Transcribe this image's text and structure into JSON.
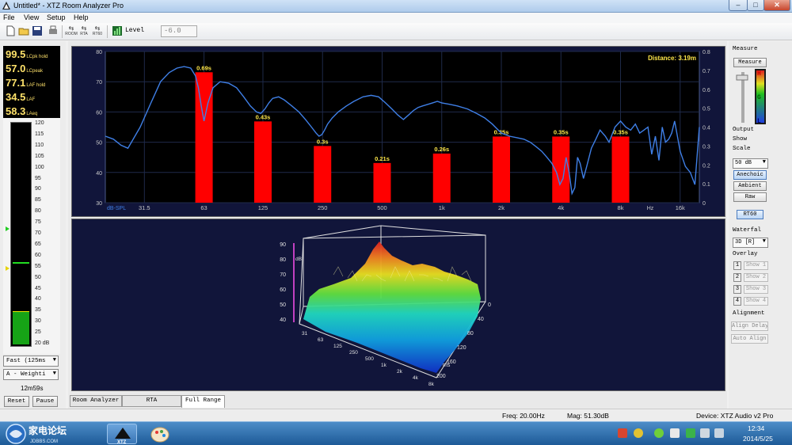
{
  "window": {
    "title": "Untitled* - XTZ Room Analyzer Pro",
    "minimize": "–",
    "maximize": "□",
    "close": "✕"
  },
  "menu": [
    "File",
    "View",
    "Setup",
    "Help"
  ],
  "toolbar": {
    "mode_labels": [
      "ROOM",
      "RTA",
      "RT60"
    ],
    "level_label": "Level",
    "level_value": "-6.0",
    "icons": [
      "new-icon",
      "open-icon",
      "save-icon",
      "print-icon",
      "room-icon",
      "rta-icon",
      "rt60-icon",
      "level-icon"
    ]
  },
  "meter_panel": {
    "readouts": [
      {
        "value": "99.5",
        "unit": "LCpk hold"
      },
      {
        "value": "57.0",
        "unit": "LCpeak"
      },
      {
        "value": "77.1",
        "unit": "LAF hold"
      },
      {
        "value": "34.5",
        "unit": "LAF"
      },
      {
        "value": "58.3",
        "unit": "LAeq"
      }
    ],
    "scale_ticks": [
      "120",
      "115",
      "110",
      "105",
      "100",
      "95",
      "90",
      "85",
      "80",
      "75",
      "70",
      "65",
      "60",
      "55",
      "50",
      "45",
      "40",
      "35",
      "30",
      "25",
      "20 dB"
    ],
    "scale_max": 120,
    "scale_min": 20,
    "level_db": 34.5,
    "hold_db": 57.0,
    "marker_green_db": 72,
    "marker_yellow_db": 54,
    "time_weight": "Fast (125ms",
    "freq_weight": "A - Weighti",
    "timer": "12m59s",
    "reset_label": "Reset",
    "pause_label": "Pause"
  },
  "chart_data": {
    "type": "line",
    "distance_label": "Distance: 3.19m",
    "ylabel": "dB-SPL",
    "xunit": "Hz",
    "ylim": [
      30,
      80
    ],
    "y_ticks": [
      30,
      40,
      50,
      60,
      70,
      80
    ],
    "y2lim": [
      0,
      0.8
    ],
    "y2_ticks": [
      "0",
      "0.1",
      "0.2",
      "0.3",
      "0.4",
      "0.5",
      "0.6",
      "0.7",
      "0.8"
    ],
    "x_ticks": [
      "31.5",
      "63",
      "125",
      "250",
      "500",
      "1k",
      "2k",
      "4k",
      "8k",
      "16k"
    ],
    "x_tick_hz": [
      31.5,
      63,
      125,
      250,
      500,
      1000,
      2000,
      4000,
      8000,
      16000
    ],
    "x_range_hz": [
      20,
      20000
    ],
    "rt60": {
      "categories": [
        "63",
        "125",
        "250",
        "500",
        "1k",
        "2k",
        "4k",
        "8k"
      ],
      "values": [
        0.69,
        0.43,
        0.3,
        0.21,
        0.26,
        0.35,
        0.35,
        0.35
      ],
      "labels": [
        "0.69s",
        "0.43s",
        "0.3s",
        "0.21s",
        "0.26s",
        "0.35s",
        "0.35s",
        "0.35s"
      ],
      "color": "#ff0000"
    },
    "series": [
      {
        "color": "#3f7fe6",
        "x": [
          20,
          22,
          24,
          26,
          30,
          34,
          38,
          42,
          46,
          50,
          54,
          57,
          59,
          61,
          63,
          66,
          70,
          76,
          84,
          92,
          100,
          108,
          116,
          122,
          128,
          134,
          140,
          150,
          160,
          175,
          190,
          205,
          220,
          232,
          240,
          248,
          256,
          265,
          280,
          300,
          330,
          360,
          400,
          440,
          480,
          520,
          560,
          600,
          640,
          680,
          720,
          760,
          800,
          850,
          900,
          950,
          1000,
          1100,
          1200,
          1350,
          1500,
          1650,
          1800,
          2000,
          2200,
          2400,
          2600,
          2800,
          3000,
          3200,
          3400,
          3600,
          3800,
          3950,
          4100,
          4250,
          4400,
          4550,
          4700,
          4850,
          5000,
          5200,
          5400,
          5700,
          6000,
          6300,
          6700,
          7000,
          7500,
          8000,
          8500,
          9000,
          9500,
          10000,
          10500,
          11000,
          11500,
          12000,
          12500,
          13000,
          13500,
          14000,
          14500,
          15000,
          16000,
          17000,
          18000,
          19000,
          20000
        ],
        "y": [
          52,
          51,
          49,
          48,
          55,
          63,
          70,
          73,
          74.5,
          75,
          74.5,
          72,
          68,
          62,
          57,
          63,
          68,
          70,
          69.5,
          68,
          65,
          62,
          60,
          59.5,
          61,
          63,
          64.5,
          65,
          64,
          62,
          60,
          57.5,
          55,
          53,
          52,
          52.5,
          54,
          56,
          58,
          60,
          62,
          63.5,
          65,
          65.5,
          65,
          63,
          61,
          59,
          57.5,
          59,
          60.5,
          61.5,
          62,
          62.5,
          63,
          63.5,
          63,
          62.5,
          62,
          61,
          59.5,
          58,
          56,
          53,
          52,
          51.5,
          51,
          50,
          48.5,
          47,
          45,
          43,
          40,
          36,
          38,
          45,
          40,
          33,
          35,
          45,
          43,
          38,
          42,
          48,
          51,
          54,
          52,
          50,
          55,
          57,
          55,
          54,
          56,
          53,
          54,
          55,
          46,
          52,
          44,
          55,
          50,
          51,
          53,
          57,
          47,
          42,
          40,
          36,
          55
        ]
      }
    ]
  },
  "waterfall": {
    "z_ticks": [
      "90",
      "80",
      "70",
      "60",
      "50",
      "40"
    ],
    "z_unit": "dB",
    "time_ticks": [
      "0",
      "40",
      "80",
      "120",
      "160",
      "200"
    ],
    "time_unit": "ms",
    "freq_ticks": [
      "31",
      "63",
      "125",
      "250",
      "500",
      "1k",
      "2k",
      "4k",
      "8k"
    ]
  },
  "tabs": [
    "Room Analyzer",
    "RTA",
    "Full Range"
  ],
  "active_tab": "Full Range",
  "right_panel": {
    "measure_label": "Measure",
    "measure_button": "Measure",
    "gain_letters": [
      "H",
      "G",
      "L"
    ],
    "output_label": "Output",
    "show_scale_label": "Show\nScale",
    "show_label": "Show",
    "scale_label": "Scale",
    "scale_value": "50 dB",
    "anechoic_button": "Anechoic",
    "ambient_button": "Ambient",
    "raw_button": "Raw",
    "rt60_button": "RT60",
    "waterfall_label": "Waterfal",
    "waterfall_value": "3D [R]",
    "overlay_label": "Overlay",
    "overlays": [
      {
        "num": "1",
        "label": "Show 1"
      },
      {
        "num": "2",
        "label": "Show 2"
      },
      {
        "num": "3",
        "label": "Show 3"
      },
      {
        "num": "4",
        "label": "Show 4"
      }
    ],
    "alignment_label": "Alignment",
    "align_delay_button": "Align Delay",
    "auto_align_button": "Auto Align"
  },
  "statusbar": {
    "freq": "Freq: 20.00Hz",
    "mag": "Mag: 51.30dB",
    "device": "Device: XTZ Audio v2 Pro"
  },
  "taskbar": {
    "time": "12:34",
    "date": "2014/5/25",
    "watermark": "家电论坛",
    "watermark_sub": "JDBBS.COM",
    "app_label": "XTZ"
  }
}
